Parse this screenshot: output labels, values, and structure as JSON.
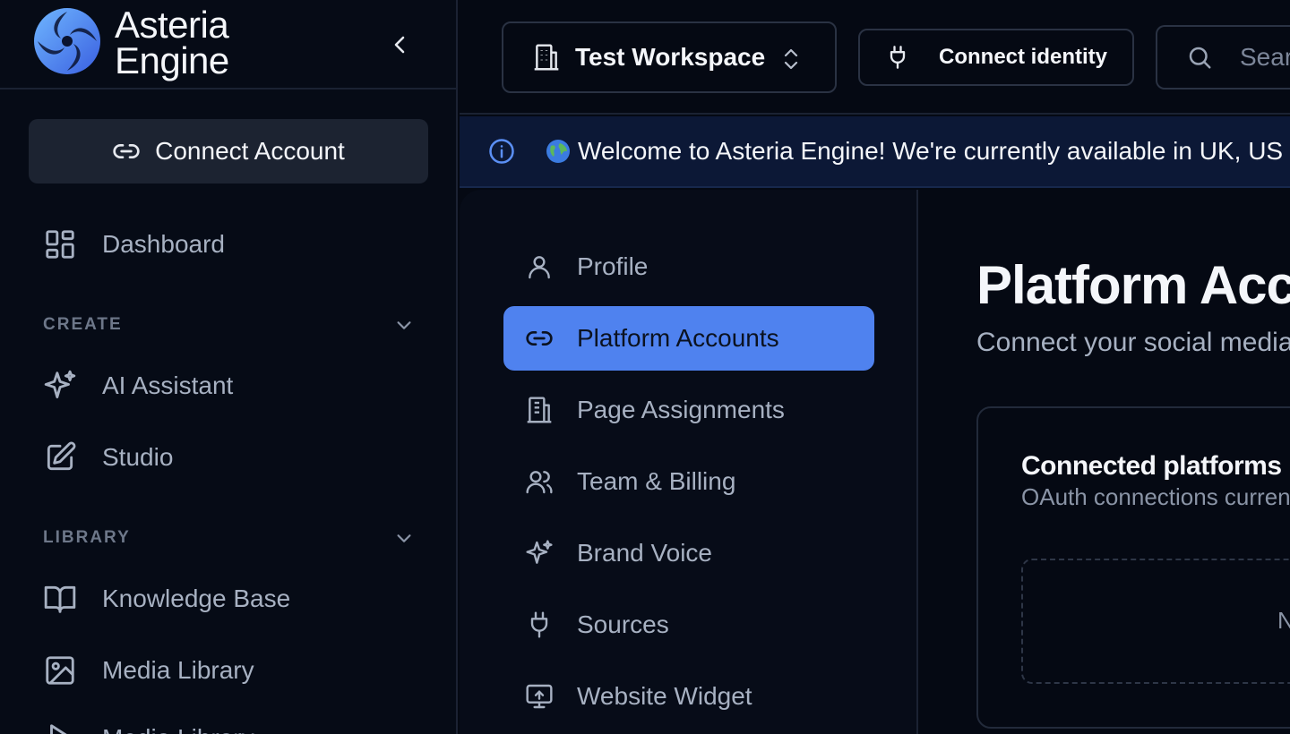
{
  "brand": {
    "line1": "Asteria",
    "line2": "Engine"
  },
  "sidebar": {
    "connect_account": "Connect Account",
    "dashboard": "Dashboard",
    "sections": {
      "create": "CREATE",
      "library": "LIBRARY"
    },
    "create_items": [
      "AI Assistant",
      "Studio"
    ],
    "library_items": [
      "Knowledge Base",
      "Media Library",
      "Media Library"
    ]
  },
  "topbar": {
    "workspace": "Test Workspace",
    "connect_identity": "Connect identity",
    "search_placeholder": "Search"
  },
  "banner": {
    "text": "Welcome to Asteria Engine! We're currently available in UK, US"
  },
  "settings_nav": {
    "items": [
      {
        "label": "Profile",
        "icon": "user-icon",
        "active": false
      },
      {
        "label": "Platform Accounts",
        "icon": "link-icon",
        "active": true
      },
      {
        "label": "Page Assignments",
        "icon": "building-icon",
        "active": false
      },
      {
        "label": "Team & Billing",
        "icon": "users-icon",
        "active": false
      },
      {
        "label": "Brand Voice",
        "icon": "sparkles-icon",
        "active": false
      },
      {
        "label": "Sources",
        "icon": "plug-icon",
        "active": false
      },
      {
        "label": "Website Widget",
        "icon": "monitor-icon",
        "active": false
      }
    ]
  },
  "content": {
    "title": "Platform Accounts",
    "subtitle": "Connect your social media accounts",
    "card": {
      "title": "Connected platforms",
      "subtitle": "OAuth connections currently active",
      "empty": "No"
    }
  },
  "colors": {
    "background": "#050913",
    "accent": "#4f82ef",
    "banner": "#0c1836"
  }
}
